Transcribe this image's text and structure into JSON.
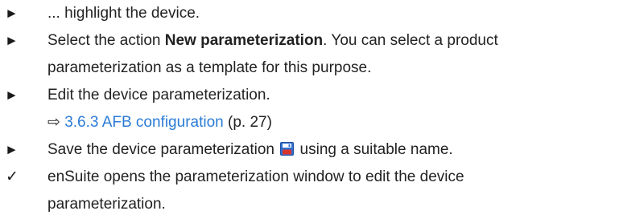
{
  "steps": [
    {
      "marker": "►",
      "line1": "... highlight the device."
    },
    {
      "marker": "►",
      "prefix": "Select the action ",
      "bold": "New parameterization",
      "suffix": ". You can select a product",
      "line2": "parameterization as a template for this purpose."
    },
    {
      "marker": "►",
      "line1": "Edit the device parameterization.",
      "ref_arrow": "⇨",
      "ref_link": "3.6.3 AFB configuration",
      "ref_page": "(p. 27)"
    },
    {
      "marker": "►",
      "prefix": "Save the device parameterization ",
      "icon": "save-icon",
      "suffix": " using a suitable name."
    },
    {
      "marker": "✓",
      "line1": "enSuite opens the parameterization window to edit the device",
      "line2": "parameterization."
    }
  ],
  "colors": {
    "link": "#2b7bd6",
    "text": "#222222",
    "icon_blue": "#2f6fd0",
    "icon_red": "#d9342b"
  }
}
